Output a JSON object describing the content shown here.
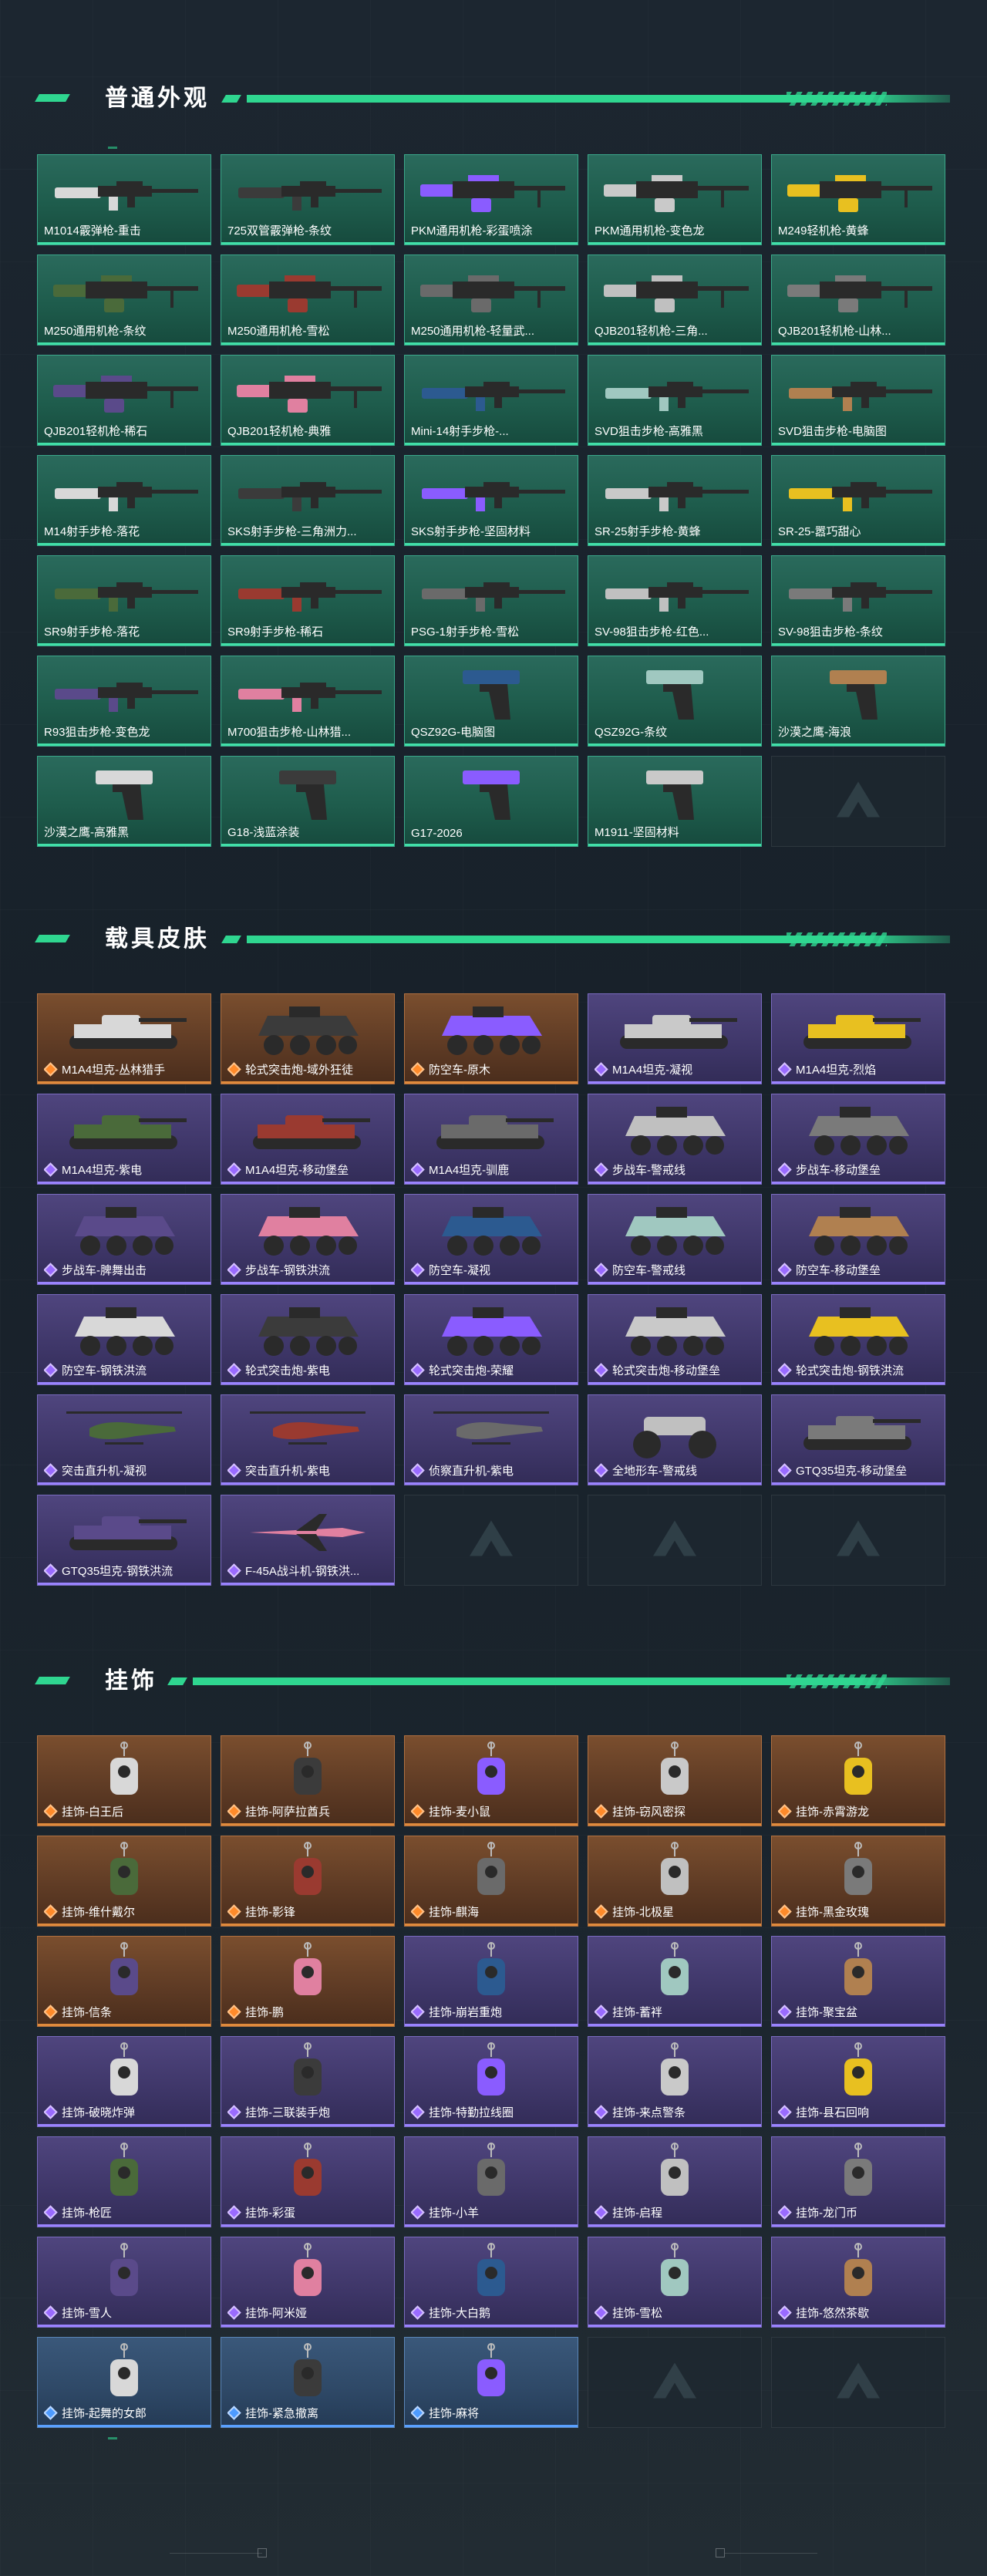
{
  "sections": {
    "weapons": {
      "title": "普通外观",
      "items": [
        {
          "label": "M1014霰弹枪-重击",
          "rarity": "green",
          "icon": "shotgun-icon"
        },
        {
          "label": "725双管霰弹枪-条纹",
          "rarity": "green",
          "icon": "shotgun-icon"
        },
        {
          "label": "PKM通用机枪-彩蛋喷涂",
          "rarity": "green",
          "icon": "machine-gun-icon"
        },
        {
          "label": "PKM通用机枪-变色龙",
          "rarity": "green",
          "icon": "machine-gun-icon"
        },
        {
          "label": "M249轻机枪-黄蜂",
          "rarity": "green",
          "icon": "machine-gun-icon"
        },
        {
          "label": "M250通用机枪-条纹",
          "rarity": "green",
          "icon": "machine-gun-icon"
        },
        {
          "label": "M250通用机枪-雪松",
          "rarity": "green",
          "icon": "machine-gun-icon"
        },
        {
          "label": "M250通用机枪-轻量武...",
          "rarity": "green",
          "icon": "machine-gun-icon"
        },
        {
          "label": "QJB201轻机枪-三角...",
          "rarity": "green",
          "icon": "machine-gun-icon"
        },
        {
          "label": "QJB201轻机枪-山林...",
          "rarity": "green",
          "icon": "machine-gun-icon"
        },
        {
          "label": "QJB201轻机枪-稀石",
          "rarity": "green",
          "icon": "machine-gun-icon"
        },
        {
          "label": "QJB201轻机枪-典雅",
          "rarity": "green",
          "icon": "machine-gun-icon"
        },
        {
          "label": "Mini-14射手步枪-...",
          "rarity": "green",
          "icon": "rifle-icon"
        },
        {
          "label": "SVD狙击步枪-高雅黑",
          "rarity": "green",
          "icon": "sniper-icon"
        },
        {
          "label": "SVD狙击步枪-电脑图",
          "rarity": "green",
          "icon": "sniper-icon"
        },
        {
          "label": "M14射手步枪-落花",
          "rarity": "green",
          "icon": "rifle-icon"
        },
        {
          "label": "SKS射手步枪-三角洲力...",
          "rarity": "green",
          "icon": "rifle-icon"
        },
        {
          "label": "SKS射手步枪-坚固材料",
          "rarity": "green",
          "icon": "rifle-icon"
        },
        {
          "label": "SR-25射手步枪-黄蜂",
          "rarity": "green",
          "icon": "rifle-icon"
        },
        {
          "label": "SR-25-嚣巧甜心",
          "rarity": "green",
          "icon": "rifle-icon"
        },
        {
          "label": "SR9射手步枪-落花",
          "rarity": "green",
          "icon": "rifle-icon"
        },
        {
          "label": "SR9射手步枪-稀石",
          "rarity": "green",
          "icon": "rifle-icon"
        },
        {
          "label": "PSG-1射手步枪-雪松",
          "rarity": "green",
          "icon": "sniper-icon"
        },
        {
          "label": "SV-98狙击步枪-红色...",
          "rarity": "green",
          "icon": "sniper-icon"
        },
        {
          "label": "SV-98狙击步枪-条纹",
          "rarity": "green",
          "icon": "sniper-icon"
        },
        {
          "label": "R93狙击步枪-变色龙",
          "rarity": "green",
          "icon": "sniper-icon"
        },
        {
          "label": "M700狙击步枪-山林猎...",
          "rarity": "green",
          "icon": "sniper-icon"
        },
        {
          "label": "QSZ92G-电脑图",
          "rarity": "green",
          "icon": "pistol-icon"
        },
        {
          "label": "QSZ92G-条纹",
          "rarity": "green",
          "icon": "pistol-icon"
        },
        {
          "label": "沙漠之鹰-海浪",
          "rarity": "green",
          "icon": "pistol-icon"
        },
        {
          "label": "沙漠之鹰-高雅黑",
          "rarity": "green",
          "icon": "pistol-icon"
        },
        {
          "label": "G18-浅蓝涂装",
          "rarity": "green",
          "icon": "pistol-icon"
        },
        {
          "label": "G17-2026",
          "rarity": "green",
          "icon": "pistol-icon"
        },
        {
          "label": "M1911-坚固材料",
          "rarity": "green",
          "icon": "pistol-icon"
        },
        {
          "label": "",
          "rarity": "empty",
          "icon": "logo-icon"
        }
      ]
    },
    "vehicles": {
      "title": "载具皮肤",
      "items": [
        {
          "label": "M1A4坦克-丛林猎手",
          "rarity": "gold",
          "icon": "tank-icon"
        },
        {
          "label": "轮式突击炮-域外狂徒",
          "rarity": "gold",
          "icon": "armored-car-icon"
        },
        {
          "label": "防空车-原木",
          "rarity": "gold",
          "icon": "apc-icon"
        },
        {
          "label": "M1A4坦克-凝视",
          "rarity": "purple",
          "icon": "tank-icon"
        },
        {
          "label": "M1A4坦克-烈焰",
          "rarity": "purple",
          "icon": "tank-icon"
        },
        {
          "label": "M1A4坦克-紫电",
          "rarity": "purple",
          "icon": "tank-icon"
        },
        {
          "label": "M1A4坦克-移动堡垒",
          "rarity": "purple",
          "icon": "tank-icon"
        },
        {
          "label": "M1A4坦克-驯鹿",
          "rarity": "purple",
          "icon": "tank-icon"
        },
        {
          "label": "步战车-警戒线",
          "rarity": "purple",
          "icon": "apc-icon"
        },
        {
          "label": "步战车-移动堡垒",
          "rarity": "purple",
          "icon": "apc-icon"
        },
        {
          "label": "步战车-脾舞出击",
          "rarity": "purple",
          "icon": "apc-icon"
        },
        {
          "label": "步战车-钢铁洪流",
          "rarity": "purple",
          "icon": "apc-icon"
        },
        {
          "label": "防空车-凝视",
          "rarity": "purple",
          "icon": "apc-icon"
        },
        {
          "label": "防空车-警戒线",
          "rarity": "purple",
          "icon": "apc-icon"
        },
        {
          "label": "防空车-移动堡垒",
          "rarity": "purple",
          "icon": "apc-icon"
        },
        {
          "label": "防空车-钢铁洪流",
          "rarity": "purple",
          "icon": "apc-icon"
        },
        {
          "label": "轮式突击炮-紫电",
          "rarity": "purple",
          "icon": "armored-car-icon"
        },
        {
          "label": "轮式突击炮-荣耀",
          "rarity": "purple",
          "icon": "armored-car-icon"
        },
        {
          "label": "轮式突击炮-移动堡垒",
          "rarity": "purple",
          "icon": "armored-car-icon"
        },
        {
          "label": "轮式突击炮-钢铁洪流",
          "rarity": "purple",
          "icon": "armored-car-icon"
        },
        {
          "label": "突击直升机-凝视",
          "rarity": "purple",
          "icon": "helicopter-icon"
        },
        {
          "label": "突击直升机-紫电",
          "rarity": "purple",
          "icon": "helicopter-icon"
        },
        {
          "label": "侦察直升机-紫电",
          "rarity": "purple",
          "icon": "helicopter-icon"
        },
        {
          "label": "全地形车-警戒线",
          "rarity": "purple",
          "icon": "atv-icon"
        },
        {
          "label": "GTQ35坦克-移动堡垒",
          "rarity": "purple",
          "icon": "tank-icon"
        },
        {
          "label": "GTQ35坦克-钢铁洪流",
          "rarity": "purple",
          "icon": "tank-icon"
        },
        {
          "label": "F-45A战斗机-钢铁洪...",
          "rarity": "purple",
          "icon": "jet-icon"
        },
        {
          "label": "",
          "rarity": "empty",
          "icon": "logo-icon"
        },
        {
          "label": "",
          "rarity": "empty",
          "icon": "logo-icon"
        },
        {
          "label": "",
          "rarity": "empty",
          "icon": "logo-icon"
        }
      ]
    },
    "charms": {
      "title": "挂饰",
      "items": [
        {
          "label": "挂饰-白王后",
          "rarity": "gold",
          "icon": "charm-icon"
        },
        {
          "label": "挂饰-阿萨拉酋兵",
          "rarity": "gold",
          "icon": "charm-icon"
        },
        {
          "label": "挂饰-麦小鼠",
          "rarity": "gold",
          "icon": "charm-icon"
        },
        {
          "label": "挂饰-窃风密探",
          "rarity": "gold",
          "icon": "charm-icon"
        },
        {
          "label": "挂饰-赤霄游龙",
          "rarity": "gold",
          "icon": "charm-icon"
        },
        {
          "label": "挂饰-维什戴尔",
          "rarity": "gold",
          "icon": "charm-icon"
        },
        {
          "label": "挂饰-影锋",
          "rarity": "gold",
          "icon": "charm-icon"
        },
        {
          "label": "挂饰-麒海",
          "rarity": "gold",
          "icon": "charm-icon"
        },
        {
          "label": "挂饰-北极星",
          "rarity": "gold",
          "icon": "charm-icon"
        },
        {
          "label": "挂饰-黑金玫瑰",
          "rarity": "gold",
          "icon": "charm-icon"
        },
        {
          "label": "挂饰-信条",
          "rarity": "gold",
          "icon": "charm-icon"
        },
        {
          "label": "挂饰-鹏",
          "rarity": "gold",
          "icon": "charm-icon"
        },
        {
          "label": "挂饰-崩岩重炮",
          "rarity": "purple",
          "icon": "charm-icon"
        },
        {
          "label": "挂饰-蓄袢",
          "rarity": "purple",
          "icon": "charm-icon"
        },
        {
          "label": "挂饰-聚宝盆",
          "rarity": "purple",
          "icon": "charm-icon"
        },
        {
          "label": "挂饰-破晓炸弹",
          "rarity": "purple",
          "icon": "charm-icon"
        },
        {
          "label": "挂饰-三联装手炮",
          "rarity": "purple",
          "icon": "charm-icon"
        },
        {
          "label": "挂饰-特勤拉线圈",
          "rarity": "purple",
          "icon": "charm-icon"
        },
        {
          "label": "挂饰-来点警条",
          "rarity": "purple",
          "icon": "charm-icon"
        },
        {
          "label": "挂饰-县石回响",
          "rarity": "purple",
          "icon": "charm-icon"
        },
        {
          "label": "挂饰-枪匠",
          "rarity": "purple",
          "icon": "charm-icon"
        },
        {
          "label": "挂饰-彩蛋",
          "rarity": "purple",
          "icon": "charm-icon"
        },
        {
          "label": "挂饰-小羊",
          "rarity": "purple",
          "icon": "charm-icon"
        },
        {
          "label": "挂饰-启程",
          "rarity": "purple",
          "icon": "charm-icon"
        },
        {
          "label": "挂饰-龙门币",
          "rarity": "purple",
          "icon": "charm-icon"
        },
        {
          "label": "挂饰-雪人",
          "rarity": "purple",
          "icon": "charm-icon"
        },
        {
          "label": "挂饰-阿米娅",
          "rarity": "purple",
          "icon": "charm-icon"
        },
        {
          "label": "挂饰-大白鹅",
          "rarity": "purple",
          "icon": "charm-icon"
        },
        {
          "label": "挂饰-雪松",
          "rarity": "purple",
          "icon": "charm-icon"
        },
        {
          "label": "挂饰-悠然茶歇",
          "rarity": "purple",
          "icon": "charm-icon"
        },
        {
          "label": "挂饰-起舞的女郎",
          "rarity": "blue",
          "icon": "charm-icon"
        },
        {
          "label": "挂饰-紧急撤离",
          "rarity": "blue",
          "icon": "charm-icon"
        },
        {
          "label": "挂饰-麻将",
          "rarity": "blue",
          "icon": "charm-icon"
        },
        {
          "label": "",
          "rarity": "empty",
          "icon": "logo-icon"
        },
        {
          "label": "",
          "rarity": "empty",
          "icon": "logo-icon"
        }
      ]
    }
  },
  "colors": {
    "accent": "#2fd690",
    "green": "#1e5c4c",
    "gold": "#5d3a24",
    "purple": "#3e3668",
    "blue": "#2e4866"
  }
}
